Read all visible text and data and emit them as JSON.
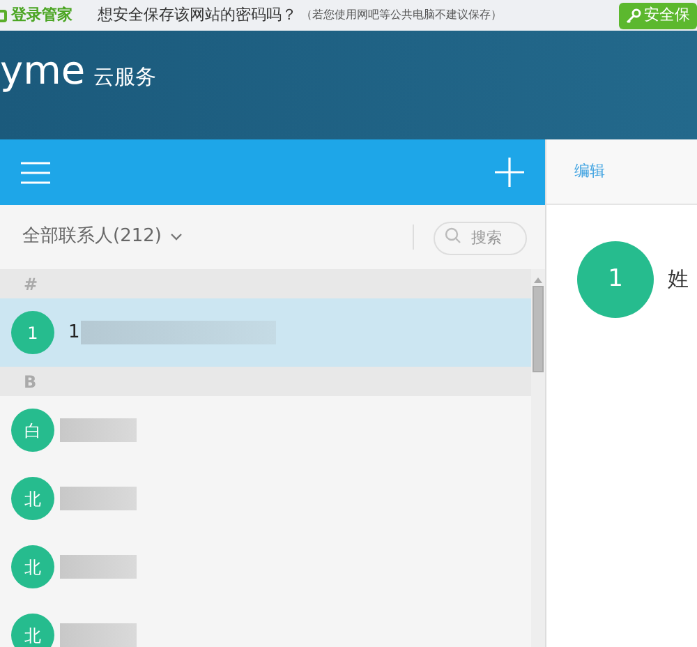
{
  "browser_bar": {
    "brand": "登录管家",
    "prompt": "想安全保存该网站的密码吗？",
    "note": "（若您使用网吧等公共电脑不建议保存）",
    "button": "安全保"
  },
  "header": {
    "logo": "yme",
    "service": "云服务"
  },
  "filter": {
    "label": "全部联系人(212)",
    "search_placeholder": "搜索"
  },
  "sections": [
    {
      "letter": "#",
      "contacts": [
        {
          "avatar": "1",
          "name": "1",
          "selected": true
        }
      ]
    },
    {
      "letter": "B",
      "contacts": [
        {
          "avatar": "白",
          "selected": false
        },
        {
          "avatar": "北",
          "selected": false
        },
        {
          "avatar": "北",
          "selected": false
        },
        {
          "avatar": "北",
          "selected": false
        }
      ]
    }
  ],
  "detail": {
    "action": "编辑",
    "avatar": "1",
    "field_label": "姓"
  }
}
